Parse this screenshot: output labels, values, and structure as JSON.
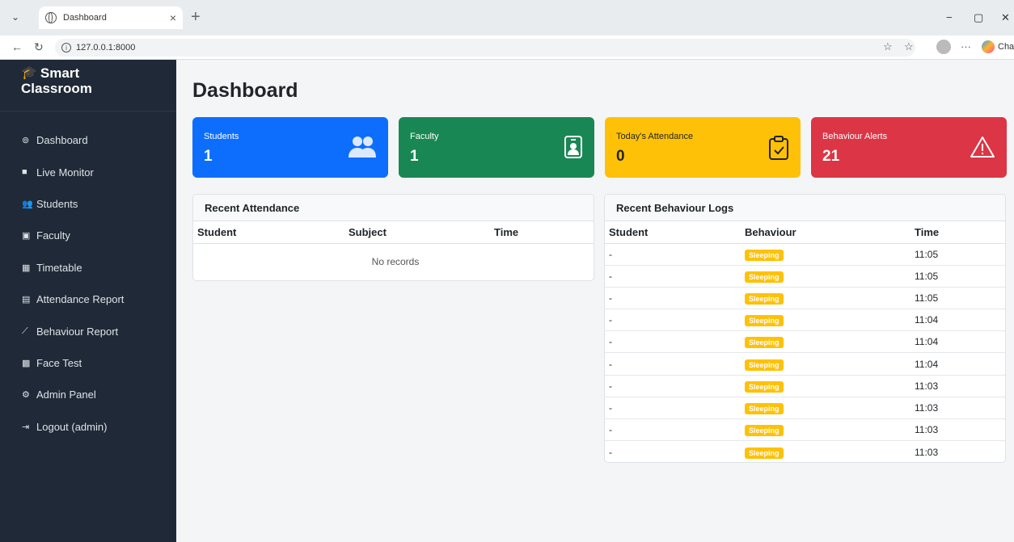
{
  "browser": {
    "tab_title": "Dashboard",
    "tab_close": "×",
    "new_tab": "+",
    "url": "127.0.0.1:8000",
    "chat_label": "Chat",
    "minimize": "−",
    "restore": "▢",
    "close": "✕"
  },
  "sidebar": {
    "brand_line1": "Smart",
    "brand_line2": "Classroom",
    "items": [
      {
        "label": "Dashboard",
        "icon": "⊚"
      },
      {
        "label": "Live Monitor",
        "icon": "■"
      },
      {
        "label": "Students",
        "icon": "👥"
      },
      {
        "label": "Faculty",
        "icon": "▣"
      },
      {
        "label": "Timetable",
        "icon": "▦"
      },
      {
        "label": "Attendance Report",
        "icon": "▤"
      },
      {
        "label": "Behaviour Report",
        "icon": "⟋"
      },
      {
        "label": "Face Test",
        "icon": "▩"
      },
      {
        "label": "Admin Panel",
        "icon": "⚙"
      },
      {
        "label": "Logout (admin)",
        "icon": "⇥"
      }
    ]
  },
  "page": {
    "title": "Dashboard"
  },
  "cards": [
    {
      "label": "Students",
      "value": "1",
      "color": "#0d6efd",
      "icon": "people-icon"
    },
    {
      "label": "Faculty",
      "value": "1",
      "color": "#198754",
      "icon": "badge-icon"
    },
    {
      "label": "Today's Attendance",
      "value": "0",
      "color": "#ffc107",
      "icon": "clipboard-check-icon"
    },
    {
      "label": "Behaviour Alerts",
      "value": "21",
      "color": "#dc3545",
      "icon": "warning-icon"
    }
  ],
  "attendance": {
    "title": "Recent Attendance",
    "columns": [
      "Student",
      "Subject",
      "Time"
    ],
    "empty_text": "No records"
  },
  "behaviour": {
    "title": "Recent Behaviour Logs",
    "columns": [
      "Student",
      "Behaviour",
      "Time"
    ],
    "rows": [
      {
        "student": "-",
        "behaviour": "Sleeping",
        "time": "11:05"
      },
      {
        "student": "-",
        "behaviour": "Sleeping",
        "time": "11:05"
      },
      {
        "student": "-",
        "behaviour": "Sleeping",
        "time": "11:05"
      },
      {
        "student": "-",
        "behaviour": "Sleeping",
        "time": "11:04"
      },
      {
        "student": "-",
        "behaviour": "Sleeping",
        "time": "11:04"
      },
      {
        "student": "-",
        "behaviour": "Sleeping",
        "time": "11:04"
      },
      {
        "student": "-",
        "behaviour": "Sleeping",
        "time": "11:03"
      },
      {
        "student": "-",
        "behaviour": "Sleeping",
        "time": "11:03"
      },
      {
        "student": "-",
        "behaviour": "Sleeping",
        "time": "11:03"
      },
      {
        "student": "-",
        "behaviour": "Sleeping",
        "time": "11:03"
      }
    ]
  }
}
